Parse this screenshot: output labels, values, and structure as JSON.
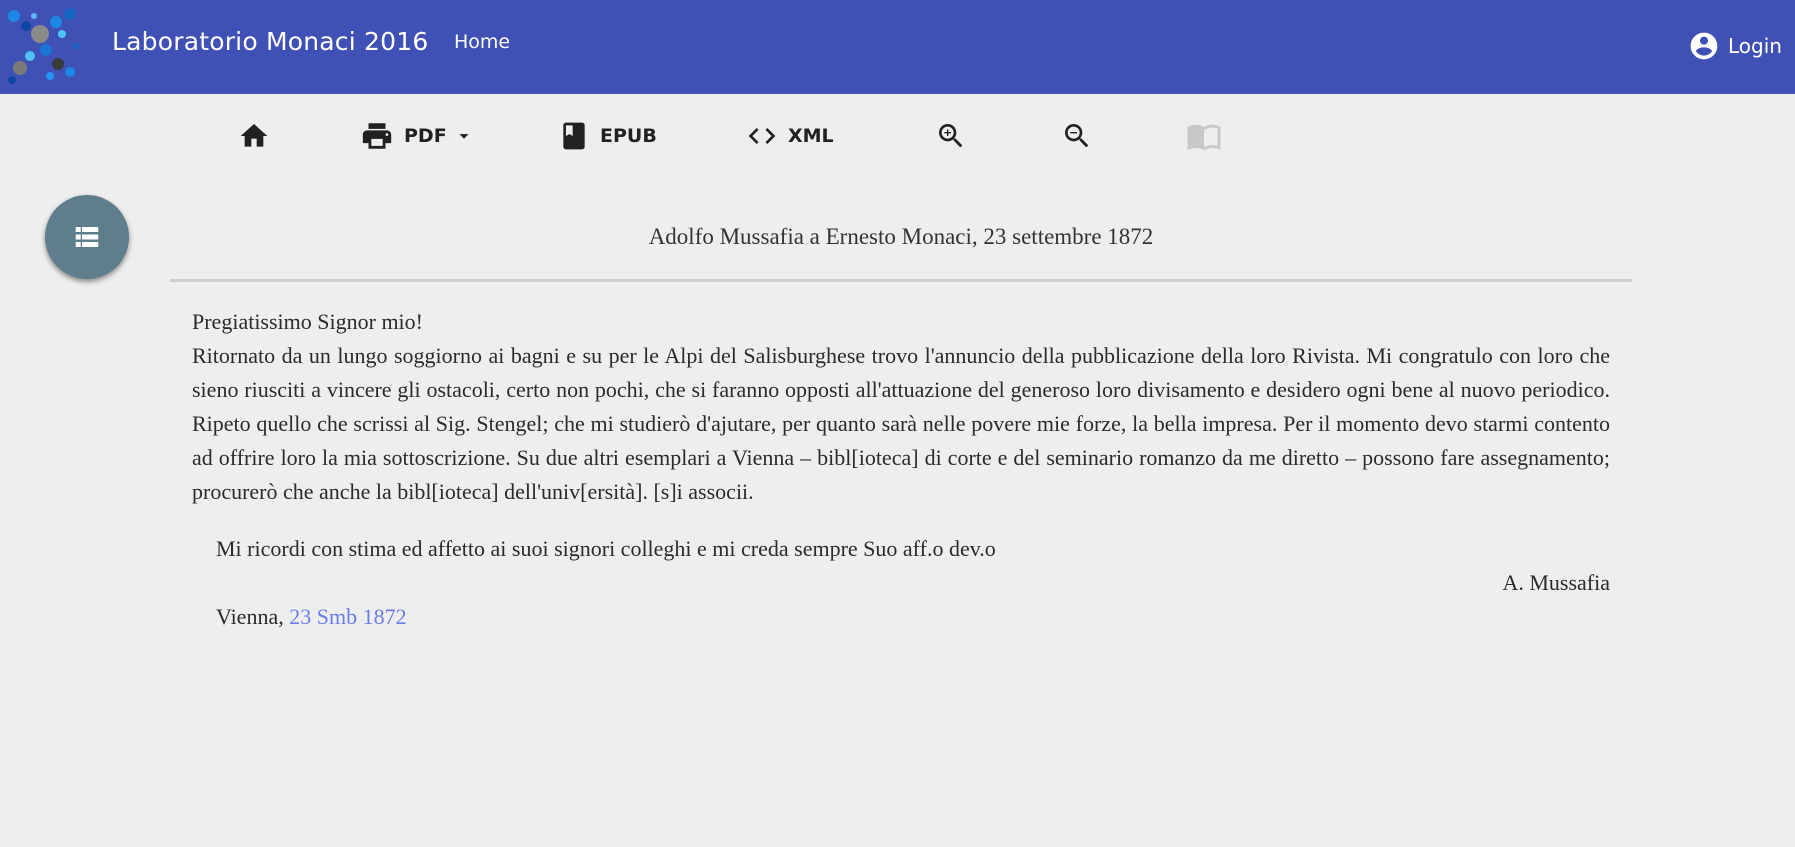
{
  "appbar": {
    "title": "Laboratorio Monaci 2016",
    "home_label": "Home",
    "login_label": "Login",
    "color": "#3f51b5"
  },
  "toolbar": {
    "items": [
      {
        "icon": "home-icon",
        "label": ""
      },
      {
        "icon": "print-icon",
        "label": "PDF",
        "dropdown": true
      },
      {
        "icon": "book-icon",
        "label": "EPUB"
      },
      {
        "icon": "code-icon",
        "label": "XML"
      },
      {
        "icon": "zoom-in-icon",
        "label": ""
      },
      {
        "icon": "zoom-out-icon",
        "label": ""
      },
      {
        "icon": "open-book-icon",
        "label": "",
        "disabled": true
      }
    ]
  },
  "fab": {
    "icon": "list-icon",
    "color": "#607d8b"
  },
  "document": {
    "title": "Adolfo Mussafia a Ernesto Monaci, 23 settembre 1872",
    "salutation": "Pregiatissimo Signor mio!",
    "body": "Ritornato da un lungo soggiorno ai bagni e su per le Alpi del Salisburghese trovo l'annuncio della pubblicazione della loro Rivista. Mi congratulo con loro che sieno riusciti a vincere gli ostacoli, certo non pochi, che si faranno opposti all'attuazione del generoso loro divisamento e desidero ogni bene al nuovo periodico. Ripeto quello che scrissi al Sig. Stengel; che mi studierò d'ajutare, per quanto sarà nelle povere mie forze, la bella impresa. Per il momento devo starmi contento ad offrire loro la mia sottoscrizione. Su due altri esemplari a Vienna – bibl[ioteca] di corte e del seminario romanzo da me diretto – possono fare assegnamento; procurerò che anche la bibl[ioteca] dell'univ[ersità]. [s]i associi.",
    "closing": "Mi ricordi con stima ed affetto ai suoi signori colleghi e mi creda sempre Suo aff.o dev.o",
    "signature": "A. Mussafia",
    "place": "Vienna, ",
    "date_link": "23 Smb 1872",
    "link_color": "#6b7ce8"
  }
}
